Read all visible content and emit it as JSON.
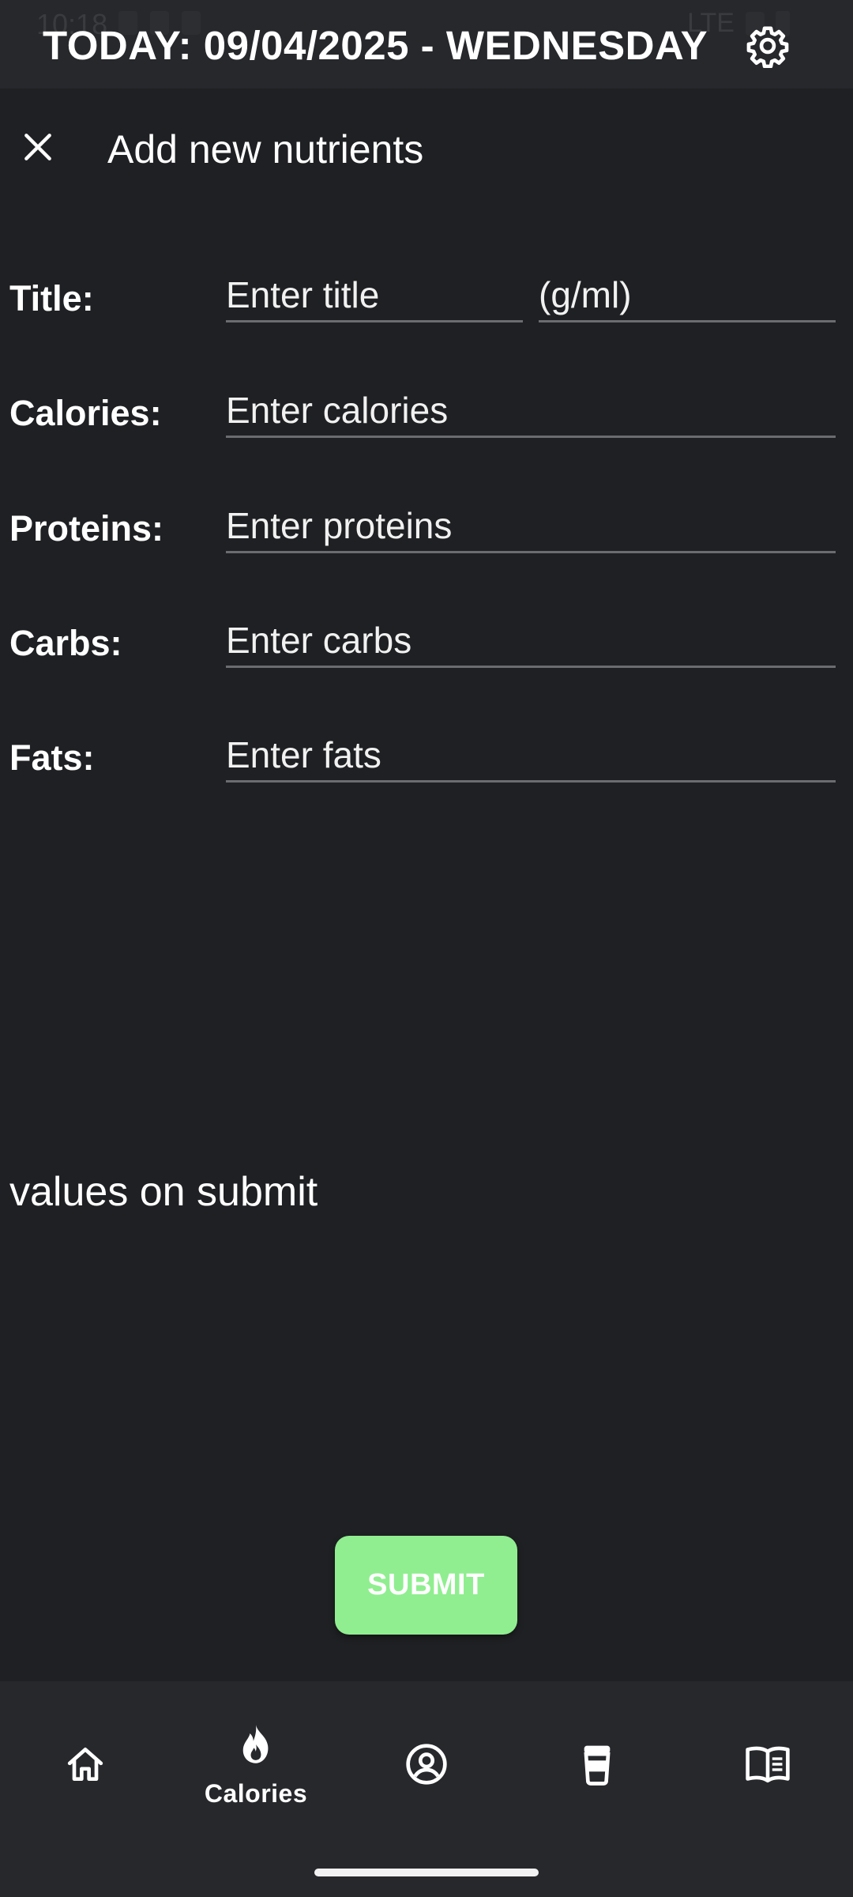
{
  "status_bar": {
    "time": "10:18",
    "network": "LTE"
  },
  "header": {
    "date_title": "TODAY: 09/04/2025 - WEDNESDAY",
    "settings_icon": "gear-icon"
  },
  "dialog": {
    "close_icon": "close-icon",
    "title": "Add new nutrients"
  },
  "form": {
    "title_label": "Title:",
    "title_placeholder": "Enter title",
    "unit_placeholder": "(g/ml)",
    "calories_label": "Calories:",
    "calories_placeholder": "Enter calories",
    "proteins_label": "Proteins:",
    "proteins_placeholder": "Enter proteins",
    "carbs_label": "Carbs:",
    "carbs_placeholder": "Enter carbs",
    "fats_label": "Fats:",
    "fats_placeholder": "Enter fats"
  },
  "values_text": "values on submit",
  "submit_label": "SUBMIT",
  "bottom_nav": {
    "items": [
      {
        "icon": "home-icon",
        "label": ""
      },
      {
        "icon": "flame-icon",
        "label": "Calories",
        "selected": true
      },
      {
        "icon": "profile-icon",
        "label": ""
      },
      {
        "icon": "cup-icon",
        "label": ""
      },
      {
        "icon": "book-icon",
        "label": ""
      }
    ]
  },
  "colors": {
    "background": "#1f2023",
    "bar_background": "#26282c",
    "submit_button": "#90ee90",
    "field_underline": "#6b6c70"
  }
}
